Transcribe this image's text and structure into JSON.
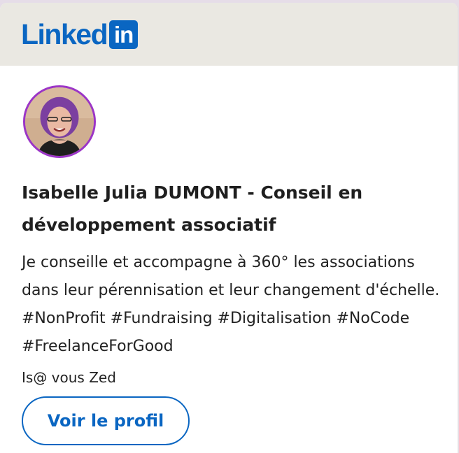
{
  "brand": {
    "logo_text": "Linked",
    "logo_box": "in",
    "color": "#0a66c2"
  },
  "profile": {
    "avatar_icon": "profile-photo",
    "name": "Isabelle Julia DUMONT - Conseil en développement associatif",
    "description": "Je conseille et accompagne à 360° les associations dans leur pérennisation et leur changement d'échelle. #NonProfit #Fundraising #Digitalisation #NoCode #FreelanceForGood",
    "subtitle": "Is@ vous Zed",
    "view_profile_label": "Voir le profil"
  },
  "colors": {
    "header_bg": "#eae8e2",
    "avatar_border": "#9b35c7"
  }
}
